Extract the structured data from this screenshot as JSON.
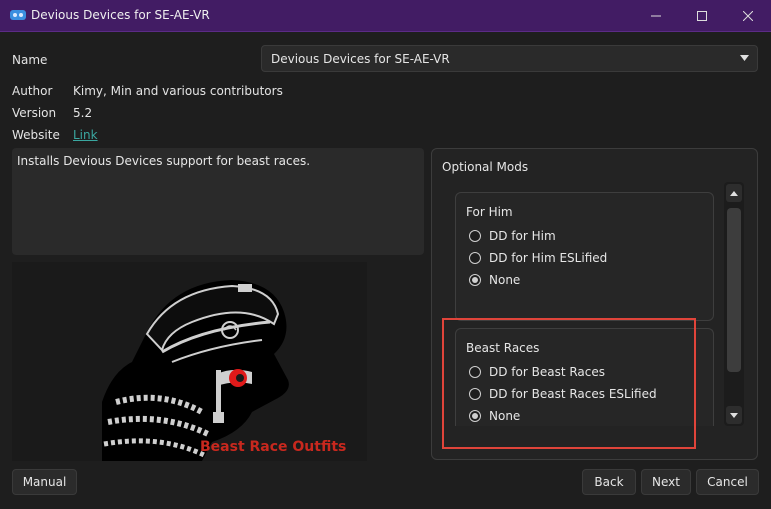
{
  "window": {
    "title": "Devious Devices for SE-AE-VR"
  },
  "info": {
    "name_label": "Name",
    "name_value": "Devious Devices for SE-AE-VR",
    "author_label": "Author",
    "author_value": "Kimy, Min and various contributors",
    "version_label": "Version",
    "version_value": "5.2",
    "website_label": "Website",
    "website_link": "Link"
  },
  "description": "Installs Devious Devices support for beast races.",
  "preview": {
    "caption": "Beast Race Outfits"
  },
  "optional_mods": {
    "title": "Optional Mods",
    "groups": [
      {
        "title": "For Him",
        "options": [
          {
            "label": "DD for Him",
            "selected": false
          },
          {
            "label": "DD for Him ESLified",
            "selected": false
          },
          {
            "label": "None",
            "selected": true
          }
        ]
      },
      {
        "title": "Beast Races",
        "options": [
          {
            "label": "DD for Beast Races",
            "selected": false
          },
          {
            "label": "DD for Beast Races ESLified",
            "selected": false
          },
          {
            "label": "None",
            "selected": true
          }
        ]
      }
    ]
  },
  "buttons": {
    "manual": "Manual",
    "back": "Back",
    "next": "Next",
    "cancel": "Cancel"
  },
  "colors": {
    "titlebar": "#421c64",
    "highlight": "#e0443a",
    "link": "#3aa7a0"
  }
}
